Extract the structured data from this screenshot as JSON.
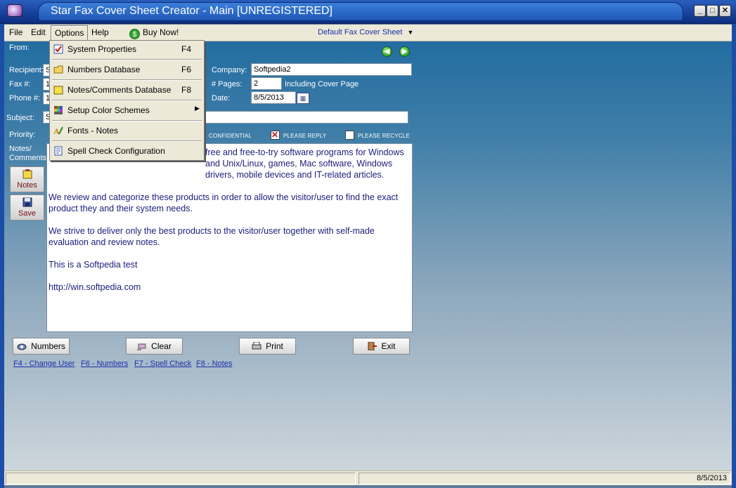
{
  "window": {
    "title": "Star Fax Cover Sheet Creator - Main [UNREGISTERED]",
    "controls": [
      "_",
      "□",
      "✕"
    ]
  },
  "menubar": {
    "file": "File",
    "edit": "Edit",
    "options": "Options",
    "help": "Help",
    "buy_now": "Buy Now!",
    "default_sheet": "Default Fax Cover Sheet"
  },
  "form": {
    "from_label": "From:",
    "recipient_label": "Recipient:",
    "recipient_value": "S",
    "fax_label": "Fax #:",
    "fax_value": "1",
    "phone_label": "Phone #:",
    "phone_value": "1",
    "company_label": "Company:",
    "company_value": "Softpedia2",
    "pages_label": "# Pages:",
    "pages_value": "2",
    "including_label": "Including Cover Page",
    "date_label": "Date:",
    "date_value": "8/5/2013",
    "subject_label": "Subject:",
    "subject_value": "S",
    "priority_label": "Priority:",
    "confidential_label": "CONFIDENTIAL",
    "please_reply_label": "PLEASE REPLY",
    "please_recycle_label": "PLEASE RECYCLE",
    "notes_label_1": "Notes/",
    "notes_label_2": "Comments:"
  },
  "notes": {
    "p1": "free and free-to-try software programs for Windows and Unix/Linux, games, Mac software, Windows drivers, mobile devices and IT-related articles.",
    "p2": "We review and categorize these products in order to allow the visitor/user to find the exact product they and their system needs.",
    "p3": "We strive to deliver only the best products to the visitor/user together with self-made evaluation and review notes.",
    "p4": "This is a Softpedia test",
    "p5": "http://win.softpedia.com"
  },
  "side_buttons": {
    "notes": "Notes",
    "save": "Save"
  },
  "bottom_buttons": {
    "numbers": "Numbers",
    "clear": "Clear",
    "print": "Print",
    "exit": "Exit"
  },
  "function_links": {
    "f4": "F4 - Change User",
    "f6": "F6 - Numbers",
    "f7": "F7 - Spell Check",
    "f8": "F8 - Notes"
  },
  "options_menu": {
    "items": [
      {
        "label": "System Properties",
        "key": "F4",
        "icon": "properties-icon"
      },
      {
        "label": "Numbers Database",
        "key": "F6",
        "icon": "folder-icon"
      },
      {
        "label": "Notes/Comments Database",
        "key": "F8",
        "icon": "notes-icon"
      },
      {
        "label": "Setup Color Schemes",
        "key": "",
        "icon": "color-grid-icon",
        "submenu": true
      },
      {
        "label": "Fonts - Notes",
        "key": "",
        "icon": "fonts-icon"
      },
      {
        "label": "Spell Check Configuration",
        "key": "",
        "icon": "spellcheck-icon"
      }
    ]
  },
  "statusbar": {
    "date": "8/5/2013"
  }
}
